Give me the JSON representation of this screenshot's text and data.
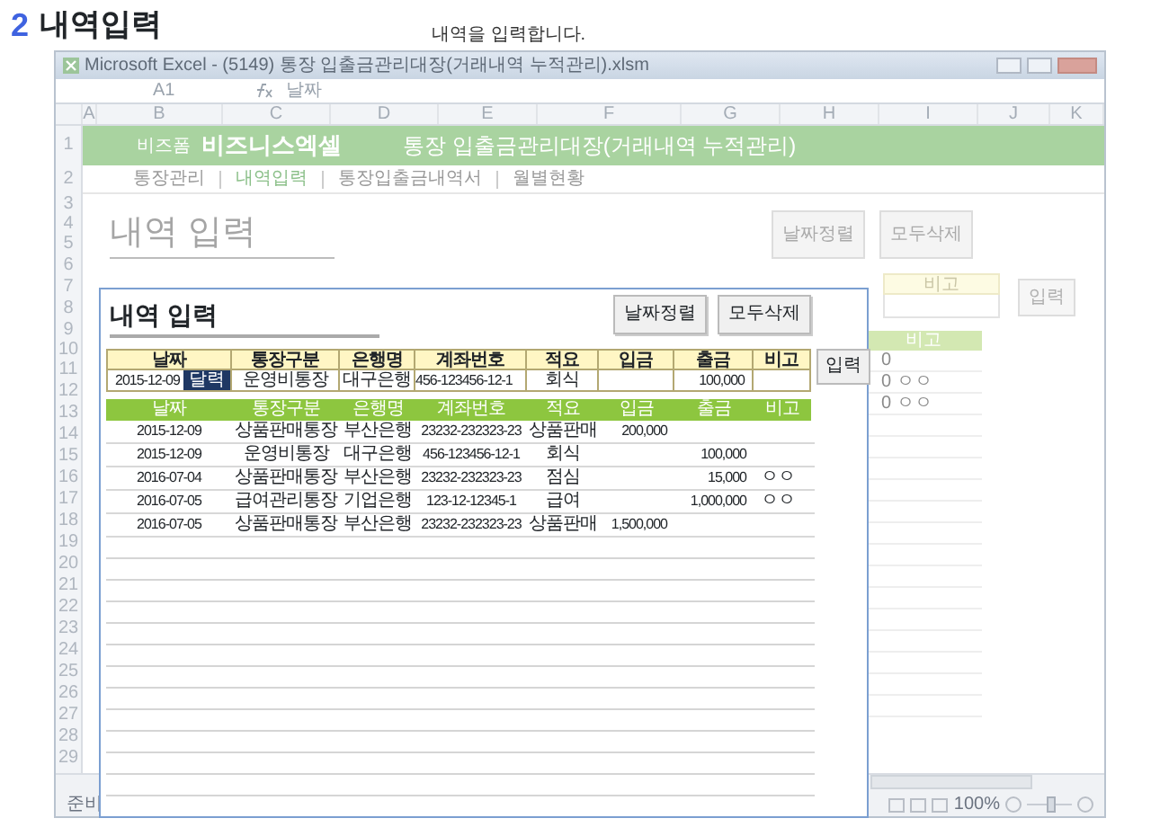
{
  "heading": {
    "number": "2",
    "title": "내역입력"
  },
  "caption": "내역을 입력합니다.",
  "excel": {
    "title": "Microsoft Excel - (5149) 통장 입출금관리대장(거래내역 누적관리).xlsm",
    "name_box": "A1",
    "formula": "날짜",
    "columns": [
      "A",
      "B",
      "C",
      "D",
      "E",
      "F",
      "G",
      "H",
      "I",
      "J",
      "K"
    ],
    "rows": [
      "1",
      "2",
      "3",
      "4",
      "5",
      "6",
      "7",
      "8",
      "9",
      "10",
      "11",
      "12",
      "13",
      "14",
      "15",
      "16",
      "17",
      "18",
      "19",
      "20",
      "21",
      "22",
      "23",
      "24",
      "25",
      "26",
      "27",
      "28",
      "29"
    ],
    "sheet": {
      "brand_small": "비즈폼",
      "brand": "비즈니스엑셀",
      "title": "통장 입출금관리대장(거래내역 누적관리)",
      "nav": [
        {
          "label": "통장관리",
          "selected": false
        },
        {
          "label": "내역입력",
          "selected": true
        },
        {
          "label": "통장입출금내역서",
          "selected": false
        },
        {
          "label": "월별현황",
          "selected": false
        }
      ],
      "heading": "내역 입력",
      "buttons": [
        "날짜정렬",
        "모두삭제"
      ],
      "input_header": "비고",
      "enter_button": "입력",
      "list_header": "비고",
      "fragments": [
        "0",
        "0 ㅇㅇ",
        "0 ㅇㅇ"
      ]
    },
    "status": "준비",
    "zoom": "100%",
    "zoom_slider": {
      "level": 0.5
    }
  },
  "inset": {
    "heading": "내역 입력",
    "buttons": [
      "날짜정렬",
      "모두삭제"
    ],
    "input_columns": [
      "날짜",
      "통장구분",
      "은행명",
      "계좌번호",
      "적요",
      "입금",
      "출금",
      "비고"
    ],
    "input_row": {
      "date": "2015-12-09",
      "account_type": "운영비통장",
      "bank": "대구은행",
      "account_no": "456-123456-12-1",
      "memo": "회식",
      "withdrawal": "100,000"
    },
    "calendar_button": "달력",
    "enter_button": "입력",
    "list_columns": [
      "날짜",
      "통장구분",
      "은행명",
      "계좌번호",
      "적요",
      "입금",
      "출금",
      "비고"
    ],
    "rows": [
      {
        "date": "2015-12-09",
        "account_type": "상품판매통장",
        "bank": "부산은행",
        "account_no": "23232-232323-23",
        "memo": "상품판매",
        "deposit": "200,000"
      },
      {
        "date": "2015-12-09",
        "account_type": "운영비통장",
        "bank": "대구은행",
        "account_no": "456-123456-12-1",
        "memo": "회식",
        "withdrawal": "100,000"
      },
      {
        "date": "2016-07-04",
        "account_type": "상품판매통장",
        "bank": "부산은행",
        "account_no": "23232-232323-23",
        "memo": "점심",
        "withdrawal": "15,000",
        "note": "ㅇㅇ"
      },
      {
        "date": "2016-07-05",
        "account_type": "급여관리통장",
        "bank": "기업은행",
        "account_no": "123-12-12345-1",
        "memo": "급여",
        "withdrawal": "1,000,000",
        "note": "ㅇㅇ"
      },
      {
        "date": "2016-07-05",
        "account_type": "상품판매통장",
        "bank": "부산은행",
        "account_no": "23232-232323-23",
        "memo": "상품판매",
        "deposit": "1,500,000"
      }
    ]
  }
}
